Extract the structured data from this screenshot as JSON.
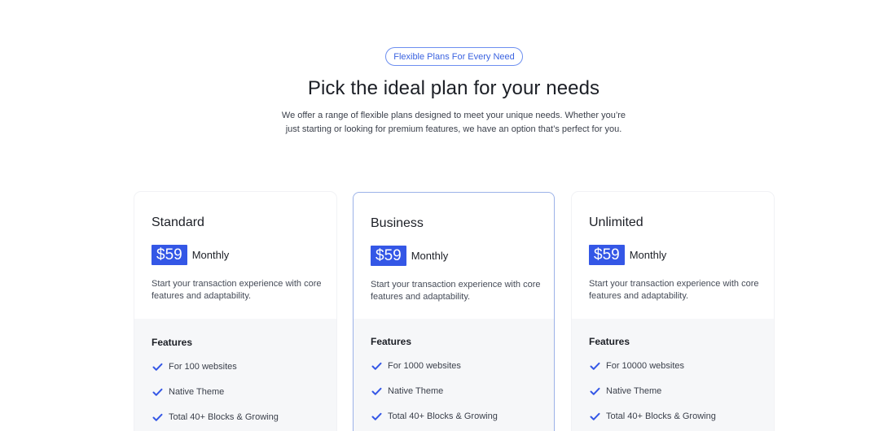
{
  "header": {
    "badge": "Flexible Plans For Every Need",
    "title": "Pick the ideal plan for your needs",
    "subtitle": "We offer a range of flexible plans designed to meet your unique needs. Whether you’re just starting or looking for premium features, we have an option that’s perfect for you."
  },
  "colors": {
    "accent": "#3457e6",
    "badge_border": "#6d8ff0",
    "featured_border": "#9cb2e8",
    "features_bg": "#f6f7f9"
  },
  "plans": [
    {
      "name": "Standard",
      "price": "$59",
      "period": "Monthly",
      "description": "Start your transaction experience with core features and adaptability.",
      "features_title": "Features",
      "features": [
        "For 100 websites",
        "Native Theme",
        "Total 40+ Blocks & Growing"
      ]
    },
    {
      "name": "Business",
      "price": "$59",
      "period": "Monthly",
      "description": "Start your transaction experience with core features and adaptability.",
      "features_title": "Features",
      "features": [
        "For 1000 websites",
        "Native Theme",
        "Total 40+ Blocks & Growing"
      ]
    },
    {
      "name": "Unlimited",
      "price": "$59",
      "period": "Monthly",
      "description": "Start your transaction experience with core features and adaptability.",
      "features_title": "Features",
      "features": [
        "For 10000 websites",
        "Native Theme",
        "Total 40+ Blocks & Growing"
      ]
    }
  ],
  "icons": {
    "feature_check": "check-icon"
  }
}
